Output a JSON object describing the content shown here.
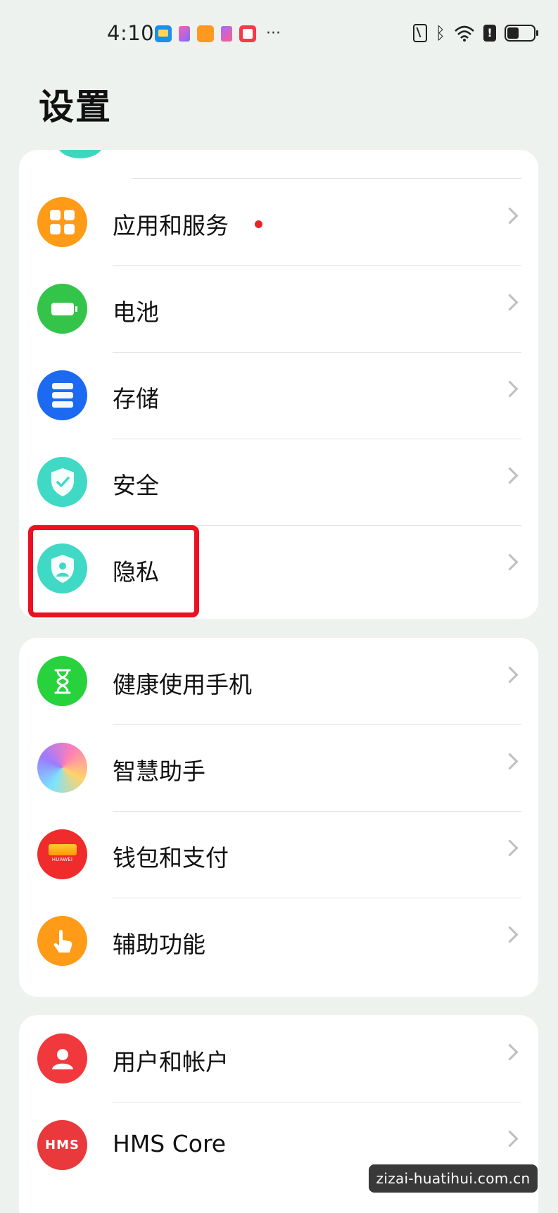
{
  "status_bar": {
    "time": "4:10",
    "more": "···",
    "alert_mark": "!"
  },
  "title": "设置",
  "groups": [
    {
      "items": [
        {
          "label": "应用和服务",
          "icon": "apps-grid-icon",
          "color": "#ff9b17",
          "badge": "red-dot"
        },
        {
          "label": "电池",
          "icon": "battery-icon",
          "color": "#35c44a"
        },
        {
          "label": "存储",
          "icon": "storage-icon",
          "color": "#1d6af2"
        },
        {
          "label": "安全",
          "icon": "shield-check-icon",
          "color": "#3fd9c6"
        },
        {
          "label": "隐私",
          "icon": "privacy-shield-icon",
          "color": "#3fd9c6",
          "highlighted": true
        }
      ]
    },
    {
      "items": [
        {
          "label": "健康使用手机",
          "icon": "hourglass-icon",
          "color": "#27d23d"
        },
        {
          "label": "智慧助手",
          "icon": "assistant-orb-icon",
          "color": "gradient"
        },
        {
          "label": "钱包和支付",
          "icon": "wallet-icon",
          "color": "#f02b2b",
          "icon_text": "HUAWEI"
        },
        {
          "label": "辅助功能",
          "icon": "hand-tap-icon",
          "color": "#ff9b17"
        }
      ]
    },
    {
      "items": [
        {
          "label": "用户和帐户",
          "icon": "user-icon",
          "color": "#f1383c"
        },
        {
          "label": "HMS Core",
          "icon": "hms-icon",
          "color": "#e9393d",
          "icon_text": "HMS"
        }
      ]
    }
  ],
  "highlight_color": "#ec1020",
  "watermark": "zizai-huatihui.com.cn"
}
